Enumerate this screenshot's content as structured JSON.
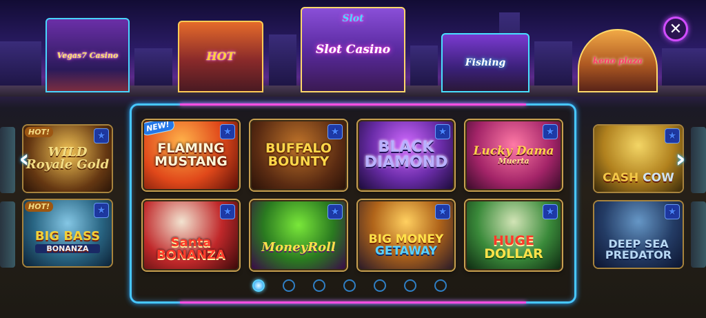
{
  "lobby": {
    "casinos": [
      {
        "name": "Vegas7 Casino"
      },
      {
        "name": "HOT"
      },
      {
        "name": "Slot Casino",
        "top": "Slot"
      },
      {
        "name": "Fishing"
      },
      {
        "name": "keno plaza"
      }
    ]
  },
  "close_button": {
    "icon": "close-icon",
    "label": "✕"
  },
  "main_games": [
    {
      "title": "FLAMING MUSTANG",
      "badge": "NEW!"
    },
    {
      "title": "BUFFALO BOUNTY"
    },
    {
      "title": "BLACK DIAMOND"
    },
    {
      "title": "Lucky Dama",
      "subtitle": "Muerta"
    },
    {
      "title": "Santa BONANZA"
    },
    {
      "title": "MoneyRoll"
    },
    {
      "title": "BIG MONEY",
      "subtitle": "GETAWAY"
    },
    {
      "title": "HUGE",
      "subtitle": "DOLLAR"
    }
  ],
  "side_games": {
    "left_top": {
      "title": "WILD Royale Gold",
      "badge": "HOT!"
    },
    "left_bottom": {
      "title": "BIG BASS",
      "subtitle": "BONANZA",
      "badge": "HOT!"
    },
    "right_top": {
      "title": "CASH",
      "subtitle": "COW"
    },
    "right_bottom": {
      "title": "DEEP SEA PREDATOR"
    }
  },
  "favorite_icon": "star-icon",
  "nav": {
    "prev": "‹",
    "next": "›"
  },
  "pagination": {
    "total": 7,
    "active": 1
  },
  "colors": {
    "frame": "#47c7ff",
    "accent": "#ff4fe3",
    "active_dot": "#5ad2ff"
  }
}
